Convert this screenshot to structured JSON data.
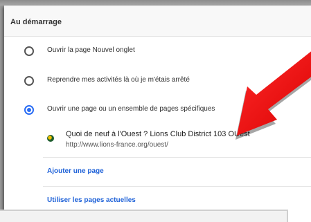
{
  "section": {
    "title": "Au démarrage"
  },
  "options": [
    {
      "label": "Ouvrir la page Nouvel onglet",
      "checked": false
    },
    {
      "label": "Reprendre mes activités là où je m'étais arrêté",
      "checked": false
    },
    {
      "label": "Ouvrir une page ou un ensemble de pages spécifiques",
      "checked": true
    }
  ],
  "page": {
    "title": "Quoi de neuf à l'Ouest ? Lions Club District 103 OUest",
    "url": "http://www.lions-france.org/ouest/",
    "icon": "lions-club-favicon"
  },
  "actions": {
    "add_page": "Ajouter une page",
    "use_current": "Utiliser les pages actuelles"
  },
  "colors": {
    "accent": "#2a6df4",
    "link": "#1f62d8",
    "arrow": "#ff1111"
  }
}
